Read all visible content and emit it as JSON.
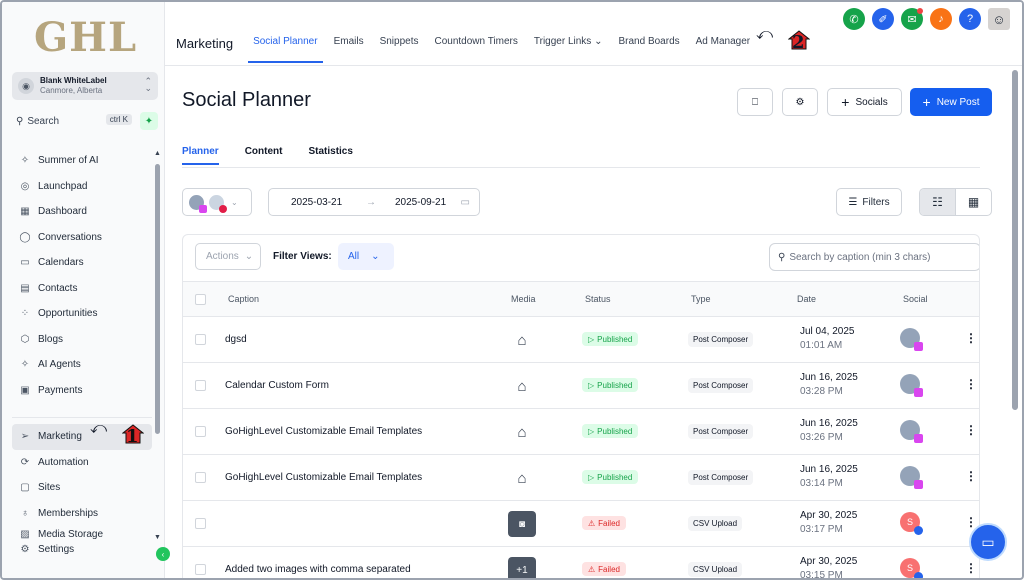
{
  "logo": "GHL",
  "account": {
    "name": "Blank WhiteLabel",
    "location": "Canmore, Alberta"
  },
  "sidebar_search": {
    "label": "Search",
    "shortcut": "ctrl K"
  },
  "sidebar": {
    "items": [
      {
        "label": "Summer of AI",
        "icon": "sparkle-icon"
      },
      {
        "label": "Launchpad",
        "icon": "rocket-icon"
      },
      {
        "label": "Dashboard",
        "icon": "grid-icon"
      },
      {
        "label": "Conversations",
        "icon": "chat-icon"
      },
      {
        "label": "Calendars",
        "icon": "calendar-icon"
      },
      {
        "label": "Contacts",
        "icon": "contacts-icon"
      },
      {
        "label": "Opportunities",
        "icon": "opportunities-icon"
      },
      {
        "label": "Blogs",
        "icon": "blog-icon"
      },
      {
        "label": "AI Agents",
        "icon": "ai-icon"
      },
      {
        "label": "Payments",
        "icon": "payments-icon"
      }
    ],
    "items2": [
      {
        "label": "Marketing",
        "icon": "send-icon",
        "active": true
      },
      {
        "label": "Automation",
        "icon": "automation-icon"
      },
      {
        "label": "Sites",
        "icon": "sites-icon"
      },
      {
        "label": "Memberships",
        "icon": "membership-icon"
      },
      {
        "label": "Media Storage",
        "icon": "media-icon"
      },
      {
        "label": "Settings",
        "icon": "gear-icon"
      }
    ]
  },
  "topbar": {
    "brand": "Marketing",
    "tabs": [
      "Social Planner",
      "Emails",
      "Snippets",
      "Countdown Timers",
      "Trigger Links",
      "Brand Boards",
      "Ad Manager"
    ],
    "active_tab": "Social Planner"
  },
  "annotations": {
    "one": "1",
    "two": "2"
  },
  "page": {
    "title": "Social Planner",
    "socials_label": "Socials",
    "new_post_label": "New Post",
    "subtabs": [
      "Planner",
      "Content",
      "Statistics"
    ],
    "date_from": "2025-03-21",
    "date_to": "2025-09-21",
    "filters_label": "Filters",
    "actions_label": "Actions",
    "filter_views_label": "Filter Views:",
    "filter_views_value": "All",
    "search_placeholder": "Search by caption (min 3 chars)"
  },
  "table": {
    "columns": [
      "Caption",
      "Media",
      "Status",
      "Type",
      "Date",
      "Social"
    ],
    "rows": [
      {
        "caption": "dgsd",
        "status": "Published",
        "type": "Post Composer",
        "date": "Jul 04, 2025",
        "time": "01:01 AM",
        "social_initial": ""
      },
      {
        "caption": "Calendar Custom Form",
        "status": "Published",
        "type": "Post Composer",
        "date": "Jun 16, 2025",
        "time": "03:28 PM",
        "social_initial": ""
      },
      {
        "caption": "GoHighLevel Customizable Email Templates",
        "status": "Published",
        "type": "Post Composer",
        "date": "Jun 16, 2025",
        "time": "03:26 PM",
        "social_initial": ""
      },
      {
        "caption": "GoHighLevel Customizable Email Templates",
        "status": "Published",
        "type": "Post Composer",
        "date": "Jun 16, 2025",
        "time": "03:14 PM",
        "social_initial": ""
      },
      {
        "caption": "",
        "status": "Failed",
        "type": "CSV Upload",
        "date": "Apr 30, 2025",
        "time": "03:17 PM",
        "social_initial": "S"
      },
      {
        "caption": "Added two images with comma separated",
        "status": "Failed",
        "type": "CSV Upload",
        "date": "Apr 30, 2025",
        "time": "03:15 PM",
        "social_initial": "S",
        "media_extra": "+1"
      }
    ]
  },
  "colors": {
    "accent": "#155eef",
    "published": "#16a34a",
    "failed": "#dc2626",
    "logo": "#b6a57e"
  }
}
